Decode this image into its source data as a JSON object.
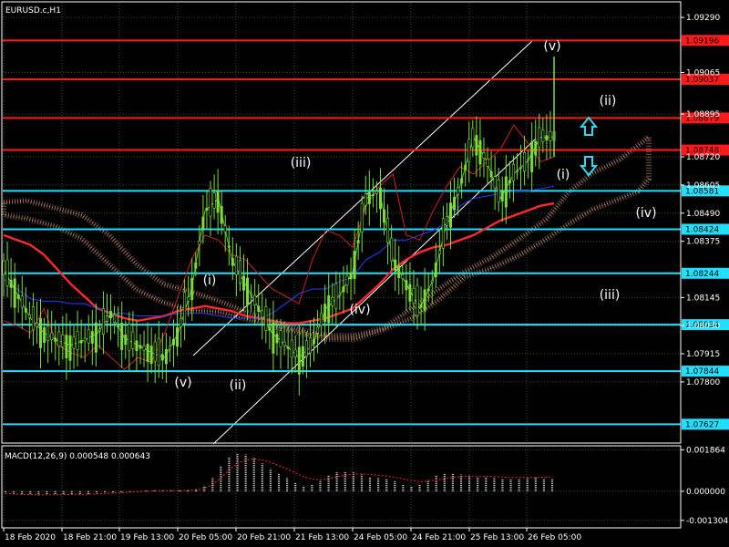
{
  "symbol_label": "EURUSD.c,H1",
  "macd_label": "MACD(12,26,9) 0.000548 0.000643",
  "colors": {
    "background": "#000000",
    "grid": "#3a4a3a",
    "frame": "#ffffff",
    "candle": "#7ddc3c",
    "ma_red": "#ff2a2a",
    "line_blue": "#2040ff",
    "line_green": "#50d020",
    "line_red_thin": "#d02020",
    "cloud": "#e0a080",
    "channel": "#ffffff",
    "level_red": "#ff1a1a",
    "level_cyan": "#20e0ff",
    "arrow_cyan": "#30d8f0",
    "macd_hist": "#d0d0d0",
    "macd_signal": "#ff2020"
  },
  "chart_data": [
    {
      "type": "line",
      "title": "EURUSD.c,H1",
      "y_ticks": [
        "1.09290",
        "1.09065",
        "1.08895",
        "1.08720",
        "1.08605",
        "1.08490",
        "1.08375",
        "1.08145",
        "1.08030",
        "1.07915",
        "1.07800"
      ],
      "ylim": [
        1.0755,
        1.0935
      ],
      "x_ticks": [
        "18 Feb 2020",
        "18 Feb 21:00",
        "19 Feb 13:00",
        "20 Feb 05:00",
        "20 Feb 21:00",
        "21 Feb 13:00",
        "24 Feb 05:00",
        "24 Feb 21:00",
        "25 Feb 13:00",
        "26 Feb 05:00"
      ],
      "levels": [
        {
          "value": 1.09196,
          "label": "1.09196",
          "color": "red"
        },
        {
          "value": 1.09037,
          "label": "1.09037",
          "color": "red"
        },
        {
          "value": 1.08879,
          "label": "1.08879",
          "color": "red"
        },
        {
          "value": 1.08748,
          "label": "1.08748",
          "color": "red"
        },
        {
          "value": 1.08581,
          "label": "1.08581",
          "color": "cyan"
        },
        {
          "value": 1.08424,
          "label": "1.08424",
          "color": "cyan"
        },
        {
          "value": 1.08244,
          "label": "1.08244",
          "color": "cyan"
        },
        {
          "value": 1.08034,
          "label": "1.08034",
          "color": "cyan"
        },
        {
          "value": 1.07844,
          "label": "1.07844",
          "color": "cyan"
        },
        {
          "value": 1.07627,
          "label": "1.07627",
          "color": "cyan"
        }
      ],
      "series": [
        {
          "type": "line",
          "values": [
            1.084,
            1.0838,
            1.0836,
            1.0832,
            1.0826,
            1.082,
            1.0815,
            1.081,
            1.0808,
            1.0806,
            1.0805,
            1.0806,
            1.0807,
            1.0809,
            1.081,
            1.0811,
            1.081,
            1.0809,
            1.0807,
            1.0806,
            1.0805,
            1.0804,
            1.0804,
            1.0805,
            1.0806,
            1.0808,
            1.081,
            1.0815,
            1.082,
            1.0826,
            1.083,
            1.0833,
            1.0835,
            1.0836,
            1.0838,
            1.084,
            1.0843,
            1.0846,
            1.0848,
            1.085,
            1.0852,
            1.0853
          ]
        },
        {
          "type": "line",
          "values": [
            1.0822,
            1.0818,
            1.0814,
            1.0813,
            1.0813,
            1.0812,
            1.0812,
            1.081,
            1.0808,
            1.0808,
            1.0807,
            1.0807,
            1.0807,
            1.0808,
            1.0808,
            1.0808,
            1.0807,
            1.0806,
            1.0806,
            1.0806,
            1.0808,
            1.0812,
            1.0816,
            1.0818,
            1.0818,
            1.0821,
            1.0823,
            1.083,
            1.0833,
            1.0838,
            1.0838,
            1.084,
            1.0842,
            1.0845,
            1.0852,
            1.0855,
            1.0856,
            1.0857,
            1.0858,
            1.0858,
            1.0859,
            1.086
          ]
        },
        {
          "type": "line",
          "values": [
            1.0826,
            1.0816,
            1.0806,
            1.08,
            1.0797,
            1.0795,
            1.0797,
            1.08,
            1.0808,
            1.0798,
            1.0795,
            1.0792,
            1.079,
            1.08,
            1.0818,
            1.085,
            1.0855,
            1.083,
            1.082,
            1.081,
            1.08,
            1.0795,
            1.079,
            1.0795,
            1.081,
            1.0815,
            1.0825,
            1.0855,
            1.0858,
            1.083,
            1.082,
            1.081,
            1.0822,
            1.0845,
            1.086,
            1.088,
            1.087,
            1.0855,
            1.0865,
            1.087,
            1.088,
            1.088
          ]
        },
        {
          "type": "line",
          "values": [
            1.0805,
            1.0803,
            1.08,
            1.081,
            1.0795,
            1.0792,
            1.079,
            1.0795,
            1.079,
            1.0785,
            1.079,
            1.0788,
            1.08,
            1.0815,
            1.083,
            1.084,
            1.0838,
            1.0832,
            1.083,
            1.0824,
            1.0818,
            1.0815,
            1.0812,
            1.083,
            1.0842,
            1.084,
            1.0835,
            1.0852,
            1.086,
            1.0865,
            1.084,
            1.0838,
            1.085,
            1.086,
            1.0868,
            1.0865,
            1.087,
            1.0875,
            1.0885,
            1.0878,
            1.087,
            1.0872
          ]
        }
      ],
      "annotations": [
        "(v)",
        "(ii)",
        "(iii)",
        "(i)",
        "(iv)",
        "(i)",
        "(iii)",
        "(iv)",
        "(ii)",
        "(v)"
      ]
    },
    {
      "type": "bar",
      "title": "MACD(12,26,9) 0.000548 0.000643",
      "y_ticks": [
        "0.001864",
        "0.000000",
        "-0.001304"
      ],
      "ylim": [
        -0.0016,
        0.002
      ],
      "series": [
        {
          "name": "MACD",
          "values": [
            -5e-05,
            -0.00012,
            -0.00014,
            -0.00016,
            -0.00018,
            -0.00017,
            -0.00016,
            -0.00015,
            -0.00013,
            -0.00014,
            -0.00012,
            -0.0001,
            -8e-05,
            -6e-05,
            -4e-05,
            -2e-05,
            0.0,
            3e-05,
            5e-05,
            4e-05,
            3e-05,
            4e-05,
            5e-05,
            0.0001,
            0.00025,
            0.0006,
            0.00115,
            0.00155,
            0.0017,
            0.00165,
            0.0015,
            0.00125,
            0.001,
            0.0008,
            0.0006,
            0.0004,
            0.00025,
            0.0003,
            0.0005,
            0.0007,
            0.00085,
            0.0009,
            0.00085,
            0.00075,
            0.00065,
            0.0006,
            0.00055,
            0.00045,
            0.0003,
            0.0002,
            0.0003,
            0.0005,
            0.0007,
            0.0008,
            0.0008,
            0.00075,
            0.0007,
            0.00065,
            0.00062,
            0.0006,
            0.00055,
            0.00055,
            0.00058,
            0.0006,
            0.00062,
            0.00058,
            0.00055
          ]
        },
        {
          "name": "Signal",
          "values": [
            -0.0001,
            -0.00012,
            -0.00014,
            -0.00015,
            -0.00016,
            -0.00016,
            -0.00016,
            -0.00015,
            -0.00014,
            -0.00014,
            -0.00013,
            -0.00012,
            -0.0001,
            -8e-05,
            -6e-05,
            -4e-05,
            -2e-05,
            0.0,
            2e-05,
            3e-05,
            3e-05,
            3e-05,
            4e-05,
            6e-05,
            0.00012,
            0.0003,
            0.0006,
            0.00095,
            0.00125,
            0.0014,
            0.00145,
            0.0014,
            0.0013,
            0.00115,
            0.001,
            0.00082,
            0.00065,
            0.00055,
            0.00052,
            0.00057,
            0.00065,
            0.00072,
            0.00077,
            0.00078,
            0.00076,
            0.00072,
            0.00068,
            0.00063,
            0.00056,
            0.00048,
            0.00044,
            0.00045,
            0.0005,
            0.00056,
            0.00062,
            0.00066,
            0.00068,
            0.00068,
            0.00067,
            0.00066,
            0.00064,
            0.00062,
            0.00062,
            0.00062,
            0.00062,
            0.00063,
            0.000643
          ]
        }
      ]
    }
  ]
}
